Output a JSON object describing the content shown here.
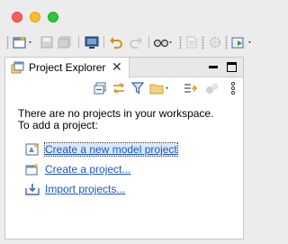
{
  "window": {
    "traffic_lights": [
      "close",
      "minimize",
      "zoom"
    ]
  },
  "toolbar": {
    "items": [
      "new-wizard-icon",
      "save-icon",
      "save-all-icon",
      "terminal-icon",
      "undo-icon",
      "redo-icon",
      "glasses-icon",
      "document-icon",
      "gear-icon",
      "run-icon"
    ]
  },
  "view": {
    "tab_label": "Project Explorer",
    "tab_close": "✕",
    "toolbar_icons": [
      "collapse-all-icon",
      "link-with-editor-icon",
      "filter-icon",
      "folder-icon",
      "sync-icon",
      "decorator-icon",
      "view-menu-icon"
    ]
  },
  "content": {
    "message_line1": "There are no projects in your workspace.",
    "message_line2": "To add a project:",
    "links": [
      {
        "label": "Create a new model project",
        "icon": "model-project-icon"
      },
      {
        "label": "Create a project...",
        "icon": "new-project-icon"
      },
      {
        "label": "Import projects...",
        "icon": "import-icon"
      }
    ]
  },
  "colors": {
    "link": "#1a56c8",
    "background": "#ececec",
    "panel": "#ffffff"
  }
}
